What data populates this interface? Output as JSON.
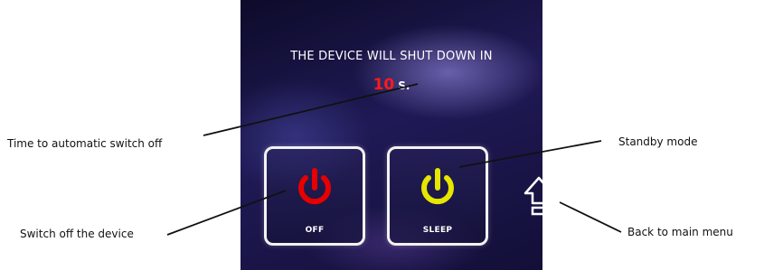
{
  "screen": {
    "heading": "THE DEVICE WILL SHUT DOWN IN",
    "countdown_value": "10",
    "countdown_unit": "S."
  },
  "buttons": {
    "off_label": "OFF",
    "sleep_label": "SLEEP"
  },
  "callouts": {
    "time_to_switch_off": "Time to automatic switch off",
    "switch_off_device": "Switch off the device",
    "standby_mode": "Standby mode",
    "back_to_main_menu": "Back to main menu"
  },
  "colors": {
    "off_icon": "#e60000",
    "sleep_icon": "#e6e600",
    "countdown_number": "#ff1a1a",
    "screen_background": "#1a1750"
  },
  "icons": {
    "off": "power-icon",
    "sleep": "power-icon",
    "home": "up-arrow-home-icon"
  }
}
